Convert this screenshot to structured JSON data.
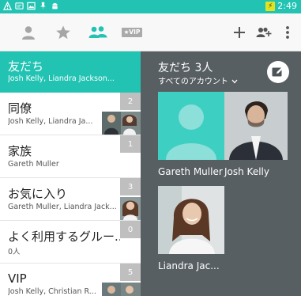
{
  "status_bar": {
    "time": "2:49",
    "icons": [
      "alert-triangle-icon",
      "message-icon",
      "image-icon",
      "pin-icon",
      "android-icon"
    ]
  },
  "toolbar": {
    "tabs": [
      "person-icon",
      "star-icon",
      "group-icon",
      "vip-icon"
    ],
    "vip_label": "★VIP",
    "actions": [
      "add-icon",
      "add-group-icon",
      "more-vert-icon"
    ]
  },
  "groups": [
    {
      "name": "友だち",
      "members": "Josh Kelly, Liandra Jackson...",
      "selected": true
    },
    {
      "name": "同僚",
      "members": "Josh Kelly, Liandra Ja...",
      "count": "2"
    },
    {
      "name": "家族",
      "members": "Gareth Muller",
      "count": "1"
    },
    {
      "name": "お気に入り",
      "members": "Gareth Muller, Liandra Jack...",
      "count": "3"
    },
    {
      "name": "よく利用するグルー...",
      "members": "0人",
      "count": "0"
    },
    {
      "name": "VIP",
      "members": "Josh Kelly, Christian R...",
      "count": "5"
    }
  ],
  "detail": {
    "title": "友だち 3人",
    "subtitle": "すべてのアカウント",
    "members": [
      {
        "name": "Gareth Muller"
      },
      {
        "name": "Josh Kelly"
      },
      {
        "name": "Liandra Jac..."
      }
    ]
  },
  "colors": {
    "accent": "#22c3b3",
    "detail_bg": "#585f63",
    "badge": "#bfbfbf"
  }
}
